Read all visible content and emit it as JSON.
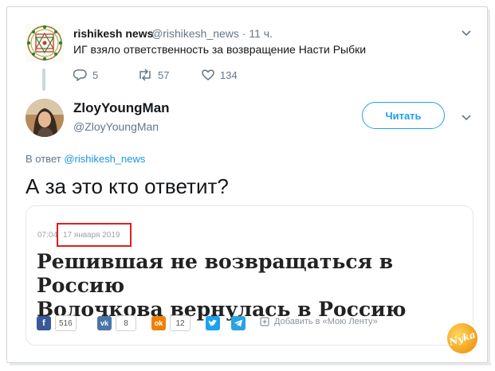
{
  "parent_tweet": {
    "display_name": "rishikesh news",
    "handle": "@rishikesh_news",
    "time": "· 11 ч.",
    "text": "ИГ взяло ответственность за возвращение Насти Рыбки",
    "replies": "5",
    "retweets": "57",
    "likes": "134"
  },
  "reply_tweet": {
    "display_name": "ZloyYoungMan",
    "handle": "@ZloyYoungMan",
    "follow_label": "Читать",
    "reply_prefix": "В ответ",
    "reply_to_handle": "@rishikesh_news",
    "text": "А за это кто ответит?"
  },
  "card": {
    "time": "07:04",
    "date": "17 января 2019",
    "headline_line1": "Решившая не возвращаться в Россию",
    "headline_line2": "Волочкова вернулась в Россию",
    "share": [
      {
        "network": "facebook",
        "letter": "f",
        "color": "#3b5998",
        "count": "516"
      },
      {
        "network": "vk",
        "letter": "vk",
        "color": "#4a76a8",
        "count": "8"
      },
      {
        "network": "odnoklassniki",
        "letter": "ok",
        "color": "#ee8208",
        "count": "12"
      },
      {
        "network": "twitter",
        "color": "#1da1f2"
      },
      {
        "network": "telegram",
        "color": "#2aa3df"
      }
    ],
    "add_label": "Добавить в «Мою Ленту»"
  },
  "watermark": "Nyka",
  "icons": [
    "mandala-avatar",
    "reply-icon",
    "retweet-icon",
    "like-icon",
    "chevron-down-icon",
    "bookmark-icon"
  ],
  "colors": {
    "accent": "#1da1f2",
    "highlight_box": "#e01e1e",
    "muted": "#657786"
  }
}
